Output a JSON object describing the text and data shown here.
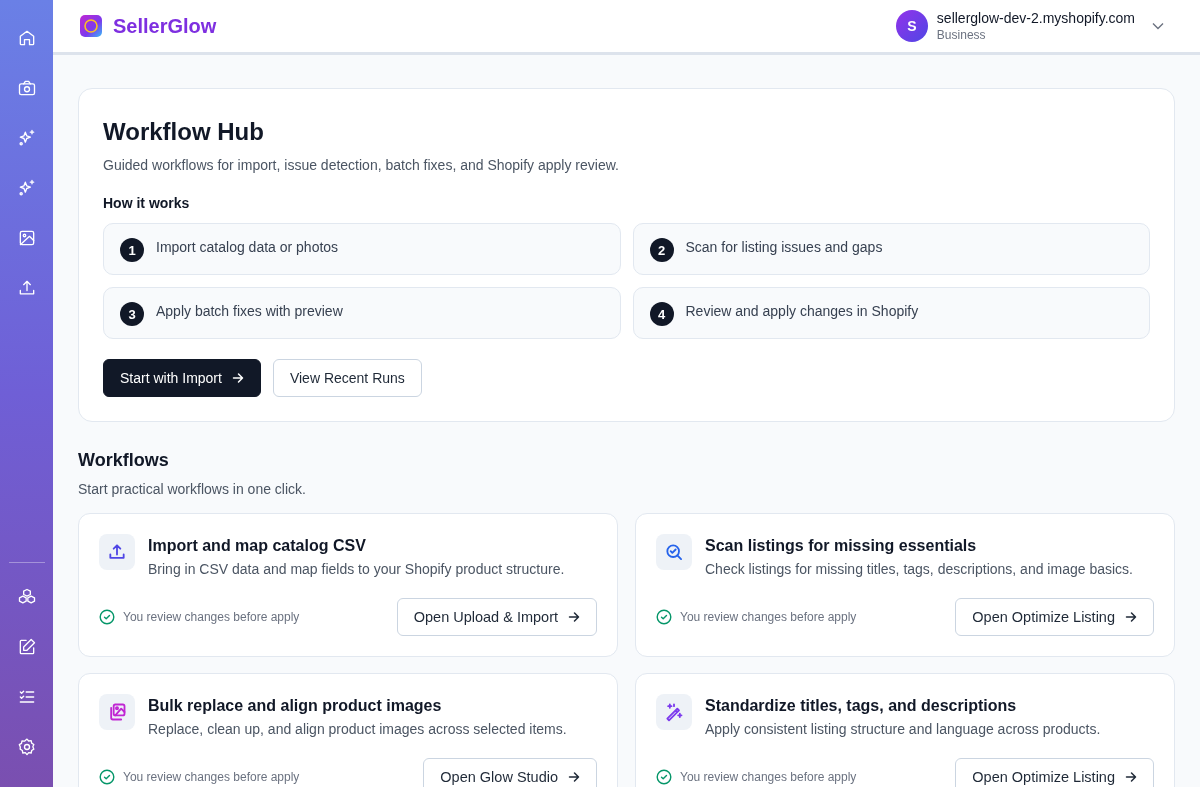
{
  "brand": {
    "name": "SellerGlow"
  },
  "account": {
    "initial": "S",
    "store": "sellerglow-dev-2.myshopify.com",
    "plan": "Business"
  },
  "hub": {
    "title": "Workflow Hub",
    "subtitle": "Guided workflows for import, issue detection, batch fixes, and Shopify apply review.",
    "steps_heading": "How it works",
    "steps": [
      {
        "number": "1",
        "text": "Import catalog data or photos"
      },
      {
        "number": "2",
        "text": "Scan for listing issues and gaps"
      },
      {
        "number": "3",
        "text": "Apply batch fixes with preview"
      },
      {
        "number": "4",
        "text": "Review and apply changes in Shopify"
      }
    ],
    "primary_button": "Start with Import",
    "secondary_button": "View Recent Runs"
  },
  "workflows": {
    "title": "Workflows",
    "subtitle": "Start practical workflows in one click.",
    "items": [
      {
        "title": "Import and map catalog CSV",
        "description": "Bring in CSV data and map fields to your Shopify product structure.",
        "note": "You review changes before apply",
        "button": "Open Upload & Import",
        "color": "#4f46e5"
      },
      {
        "title": "Scan listings for missing essentials",
        "description": "Check listings for missing titles, tags, descriptions, and image basics.",
        "note": "You review changes before apply",
        "button": "Open Optimize Listing",
        "color": "#2563eb"
      },
      {
        "title": "Bulk replace and align product images",
        "description": "Replace, clean up, and align product images across selected items.",
        "note": "You review changes before apply",
        "button": "Open Glow Studio",
        "color": "#c026d3"
      },
      {
        "title": "Standardize titles, tags, and descriptions",
        "description": "Apply consistent listing structure and language across products.",
        "note": "You review changes before apply",
        "button": "Open Optimize Listing",
        "color": "#7c3aed"
      }
    ]
  }
}
